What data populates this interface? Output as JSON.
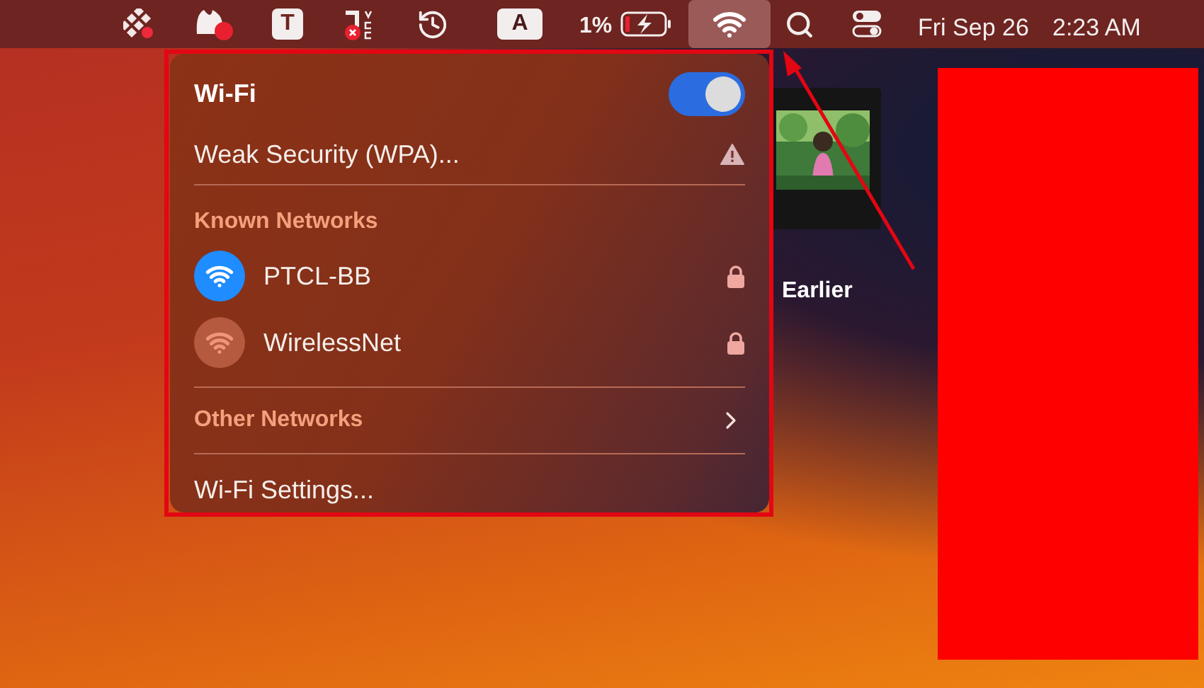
{
  "menu_bar": {
    "letter_icons": [
      "T",
      "A"
    ],
    "battery": "1%",
    "wifi_active": true,
    "date": "Fri Sep 26",
    "time": "2:23 AM"
  },
  "wifi_menu": {
    "title": "Wi-Fi",
    "on": true,
    "security_warning": "Weak Security (WPA)...",
    "known_heading": "Known Networks",
    "networks": [
      {
        "name": "PTCL-BB",
        "selected": true,
        "locked": true
      },
      {
        "name": "WirelessNet",
        "selected": false,
        "locked": true
      }
    ],
    "other_networks": "Other Networks",
    "settings": "Wi-Fi Settings..."
  },
  "desktop": {
    "file_label": "Earlier"
  }
}
